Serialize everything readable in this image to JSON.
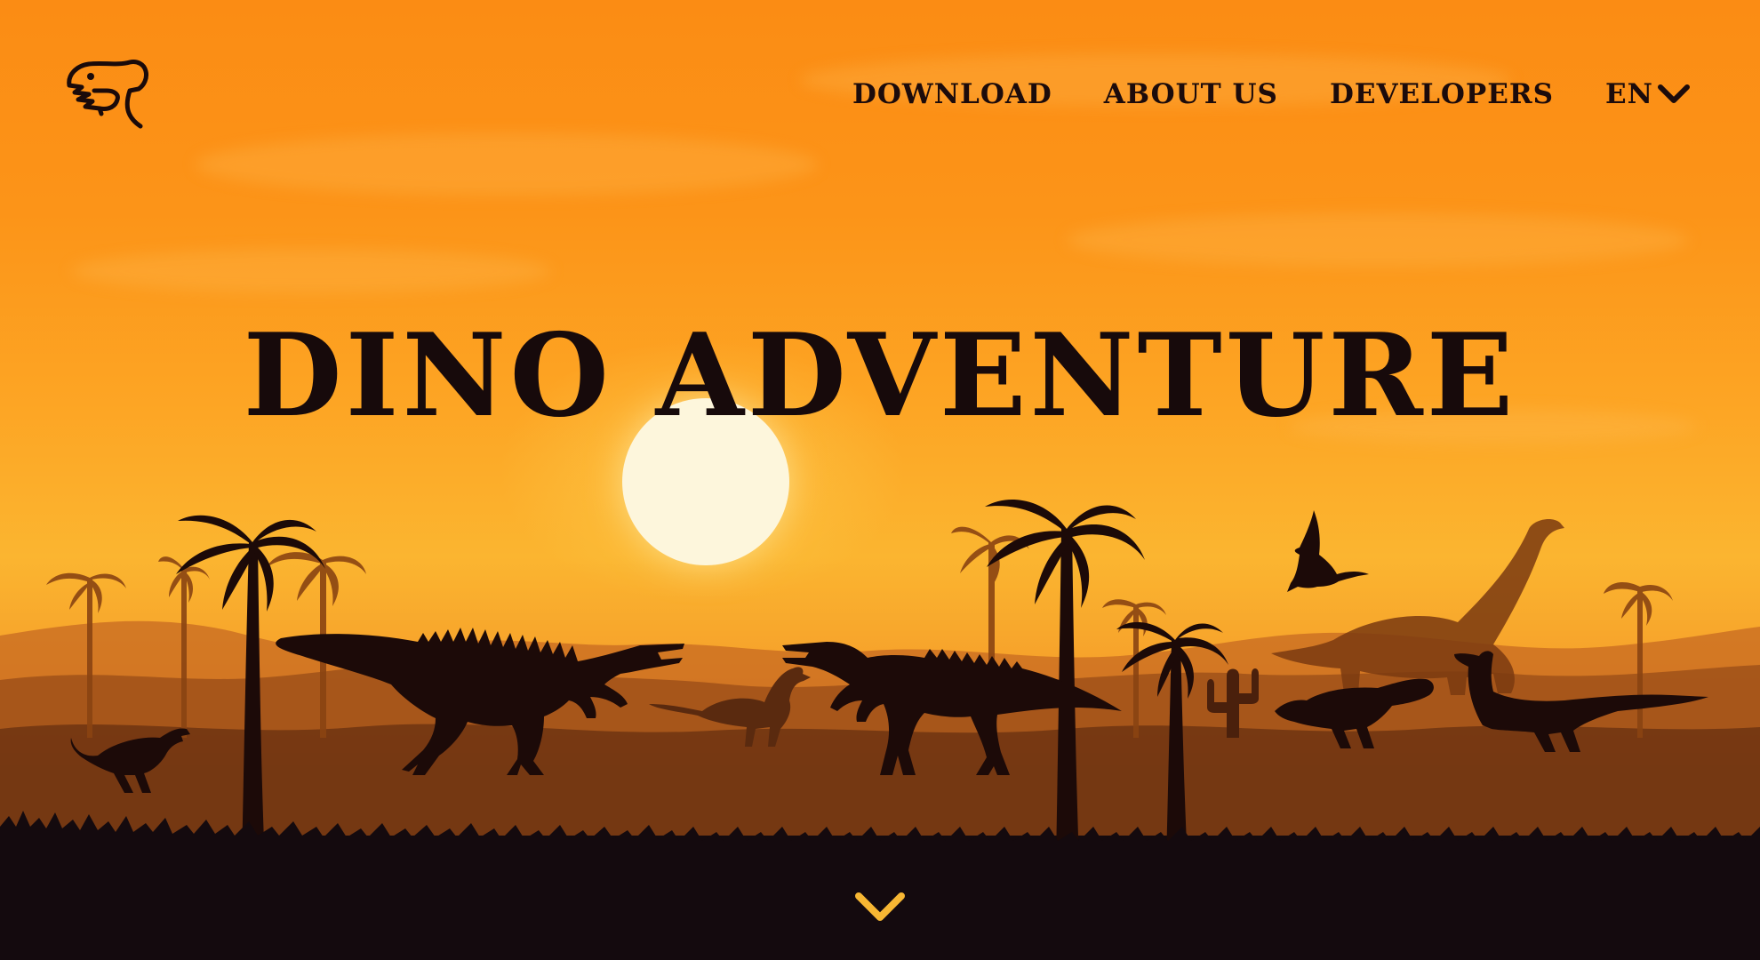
{
  "nav": {
    "items": [
      {
        "id": "download",
        "label": "DOWNLOAD"
      },
      {
        "id": "about-us",
        "label": "ABOUT US"
      },
      {
        "id": "developers",
        "label": "DEVELOPERS"
      }
    ],
    "language": {
      "selected": "EN",
      "icon": "chevron-down-icon"
    }
  },
  "hero": {
    "title": "DINO ADVENTURE"
  },
  "scroll": {
    "icon": "chevron-down-icon"
  },
  "logo": {
    "icon": "trex-head-icon"
  },
  "colors": {
    "sky_top": "#fb8c14",
    "sky_mid": "#fda524",
    "sun": "#fdf6dc",
    "ground": "#140a0e",
    "text": "#170a0b",
    "accent": "#f7b733"
  }
}
